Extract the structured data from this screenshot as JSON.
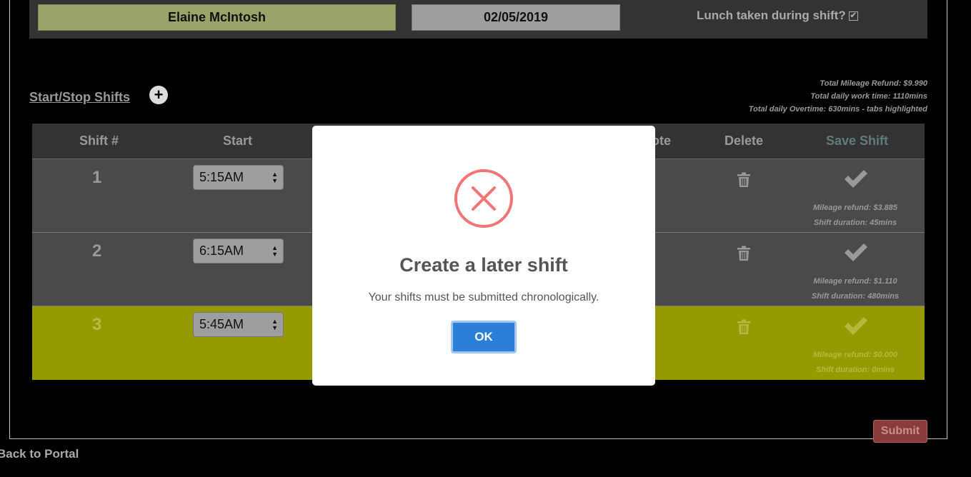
{
  "header": {
    "employee_name": "Elaine McIntosh",
    "date": "02/05/2019",
    "lunch_label": "Lunch taken during shift?",
    "lunch_checked": true
  },
  "section": {
    "title": "Start/Stop Shifts",
    "add_icon": "plus-circle-icon"
  },
  "totals": {
    "mileage": "Total Mileage Refund: $9.990",
    "work_time": "Total daily work time: 1110mins",
    "overtime": "Total daily Overtime: 630mins - tabs highlighted"
  },
  "table": {
    "headers": {
      "shift": "Shift #",
      "start": "Start",
      "note": "ote",
      "delete": "Delete",
      "save": "Save Shift"
    },
    "rows": [
      {
        "num": "1",
        "start": "5:15AM",
        "mileage": "Mileage refund: $3.885",
        "duration": "Shift duration: 45mins"
      },
      {
        "num": "2",
        "start": "6:15AM",
        "mileage": "Mileage refund: $1.110",
        "duration": "Shift duration: 480mins"
      },
      {
        "num": "3",
        "start": "5:45AM",
        "mileage": "Mileage refund: $0.000",
        "duration": "Shift duration: 0mins"
      }
    ]
  },
  "footer": {
    "submit": "Submit",
    "back": "Back to Portal"
  },
  "modal": {
    "icon": "error-x-icon",
    "title": "Create a later shift",
    "message": "Your shifts must be submitted chronologically.",
    "ok": "OK"
  },
  "colors": {
    "highlight_row": "#949a00",
    "error_red": "#f27474",
    "ok_blue": "#2b7fd6"
  }
}
